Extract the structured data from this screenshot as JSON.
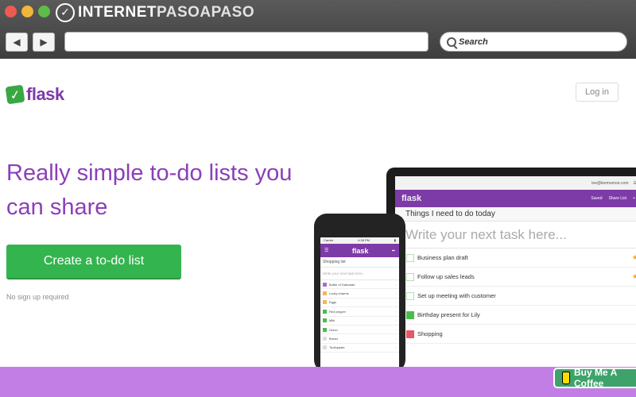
{
  "browser": {
    "brand_prefix": "INTERNET",
    "brand_suffix": "PASOAPASO",
    "back_glyph": "◀",
    "forward_glyph": "▶",
    "search_label": "Search"
  },
  "header": {
    "logo_text": "flask",
    "login_label": "Log in"
  },
  "hero": {
    "headline": "Really simple to-do lists you can share",
    "cta_label": "Create a to-do list",
    "cta_note": "No sign up required"
  },
  "laptop": {
    "account": "lee@leemunroe.com",
    "logo_text": "flask",
    "saved_label": "Saved",
    "share_label": "Share List",
    "list_title": "Things I need to do today",
    "input_placeholder": "Write your next task here...",
    "tasks": [
      {
        "label": "Business plan draft",
        "color": "",
        "starred": true
      },
      {
        "label": "Follow up sales leads",
        "color": "",
        "starred": true
      },
      {
        "label": "Set up meeting with customer",
        "color": "",
        "starred": false
      },
      {
        "label": "Birthday present for Lily",
        "color": "#4cbb4c",
        "starred": false
      },
      {
        "label": "Shopping",
        "color": "#e9566a",
        "starred": false
      }
    ]
  },
  "phone": {
    "carrier": "Carrier",
    "time": "4:38 PM",
    "logo_text": "flask",
    "list_title": "Shopping list",
    "input_placeholder": "Write your next task here...",
    "tasks": [
      {
        "label": "Bottle of Gatorade",
        "color": "#a76fcb"
      },
      {
        "label": "Lucky charms",
        "color": "#f4b55a"
      },
      {
        "label": "Eggs",
        "color": "#f4b55a"
      },
      {
        "label": "Red pepper",
        "color": "#4cbb4c"
      },
      {
        "label": "Milk",
        "color": "#4cbb4c"
      },
      {
        "label": "Onion",
        "color": "#4cbb4c"
      },
      {
        "label": "Bread",
        "color": "#dddddd"
      },
      {
        "label": "Toothpaste",
        "color": "#dddddd"
      }
    ]
  },
  "footer": {
    "coffee_label": "Buy Me A Coffee",
    "strip_color": "#c37ee6",
    "button_color": "#3ea36b"
  },
  "theme": {
    "brand_purple": "#8b3fb8",
    "cta_green": "#33b44f"
  }
}
